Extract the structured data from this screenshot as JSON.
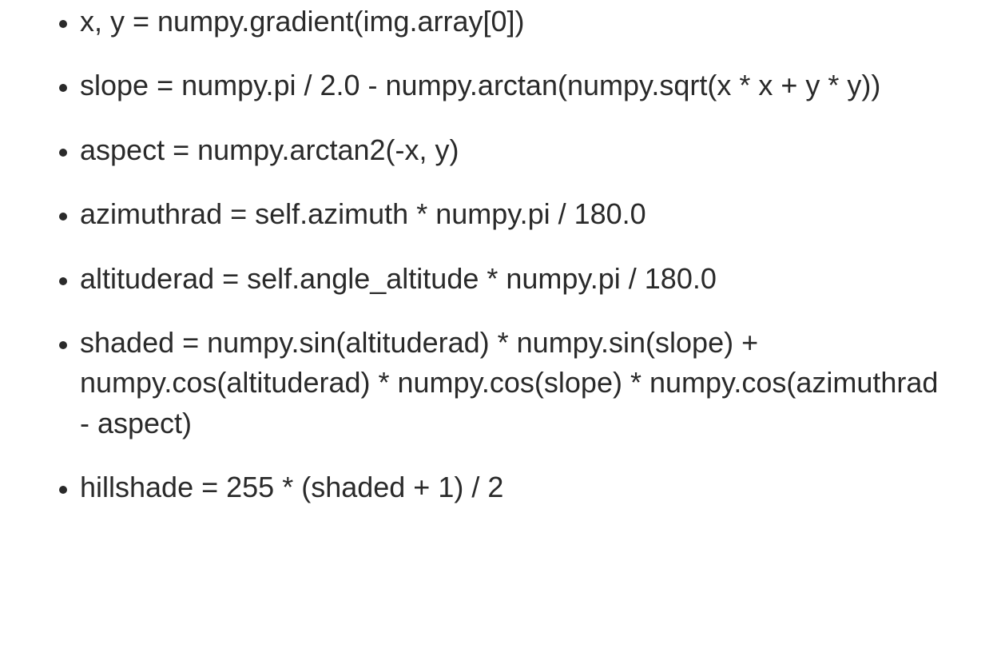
{
  "list": {
    "items": [
      "x, y = numpy.gradient(img.array[0])",
      "slope = numpy.pi / 2.0 - numpy.arctan(numpy.sqrt(x * x + y * y))",
      "aspect = numpy.arctan2(-x, y)",
      "azimuthrad = self.azimuth * numpy.pi / 180.0",
      "altituderad = self.angle_altitude * numpy.pi / 180.0",
      "shaded = numpy.sin(altituderad) * numpy.sin(slope) + numpy.cos(altituderad) * numpy.cos(slope) * numpy.cos(azimuthrad - aspect)",
      "hillshade = 255 * (shaded + 1) / 2"
    ]
  }
}
